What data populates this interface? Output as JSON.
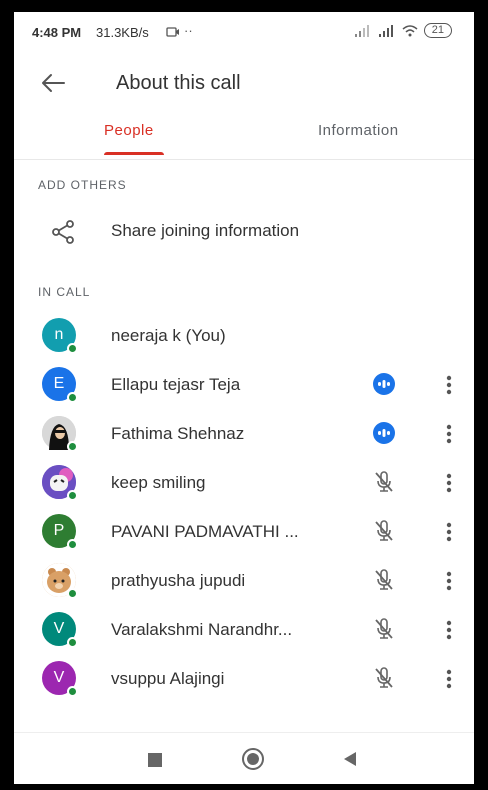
{
  "status_bar": {
    "time": "4:48 PM",
    "speed": "31.3KB/s",
    "battery": "21"
  },
  "appbar": {
    "title": "About this call",
    "back_icon": "arrow-left-icon"
  },
  "tabs": [
    {
      "label": "People",
      "active": true
    },
    {
      "label": "Information",
      "active": false
    }
  ],
  "add_others": {
    "header": "ADD OTHERS",
    "share_label": "Share joining information",
    "share_icon": "share-icon"
  },
  "in_call": {
    "header": "IN CALL",
    "participants": [
      {
        "name": "neeraja k (You)",
        "initial": "n",
        "avatar_color": "#129eaf",
        "status": "none"
      },
      {
        "name": "Ellapu tejasr Teja",
        "initial": "E",
        "avatar_color": "#1a73e8",
        "status": "speaking"
      },
      {
        "name": "Fathima Shehnaz",
        "initial": "",
        "avatar_color": "#c4c4c4",
        "status": "speaking"
      },
      {
        "name": "keep smiling",
        "initial": "",
        "avatar_color": "#7b61c9",
        "status": "muted"
      },
      {
        "name": "PAVANI PADMAVATHI ...",
        "initial": "P",
        "avatar_color": "#2e7d32",
        "status": "muted"
      },
      {
        "name": "prathyusha jupudi",
        "initial": "",
        "avatar_color": "#d9a066",
        "status": "muted"
      },
      {
        "name": "Varalakshmi Narandhr...",
        "initial": "V",
        "avatar_color": "#00897b",
        "status": "muted"
      },
      {
        "name": "vsuppu Alajingi",
        "initial": "V",
        "avatar_color": "#9c27b0",
        "status": "muted"
      }
    ]
  },
  "colors": {
    "accent": "#d93025",
    "speaking": "#1a73e8",
    "online": "#1e8e3e"
  }
}
